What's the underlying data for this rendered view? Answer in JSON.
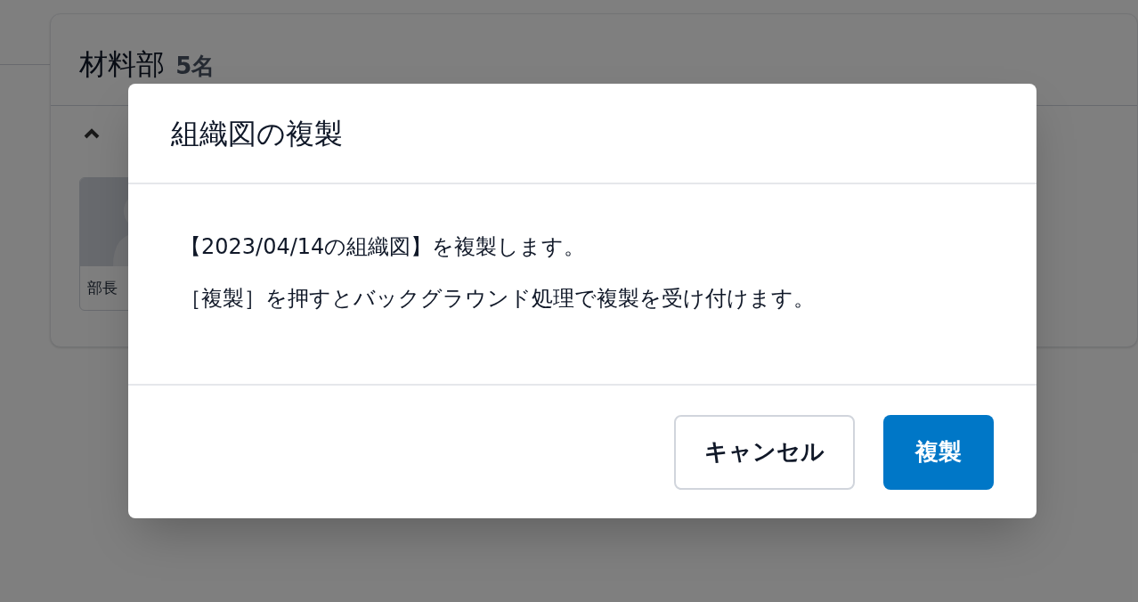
{
  "department": {
    "name": "材料部",
    "count": "5名",
    "expanded": true,
    "members": [
      {
        "role": "部長"
      }
    ]
  },
  "dialog": {
    "title": "組織図の複製",
    "lines": [
      "【2023/04/14の組織図】を複製します。",
      "［複製］を押すとバックグラウンド処理で複製を受け付けます。"
    ],
    "buttons": [
      {
        "label": "キャンセル",
        "kind": "secondary"
      },
      {
        "label": "複製",
        "kind": "primary"
      }
    ]
  }
}
